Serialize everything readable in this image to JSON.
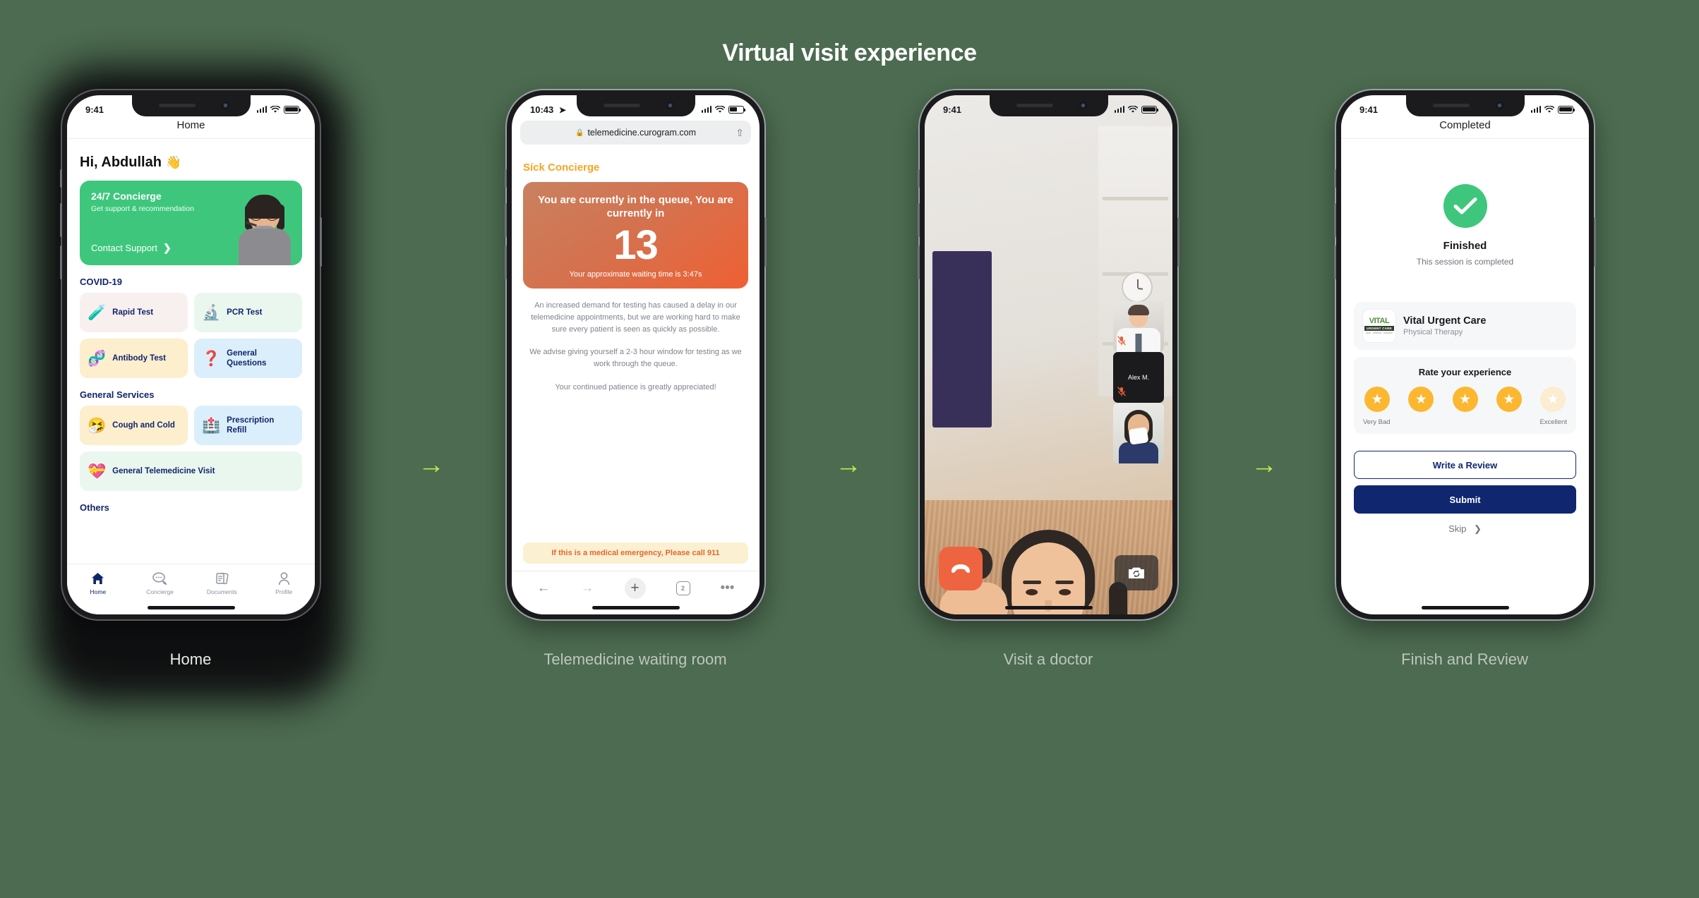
{
  "page": {
    "title": "Virtual visit experience",
    "background": "#4c6b50",
    "arrow_color": "#c4e84b",
    "arrow_glyph": "→"
  },
  "captions": {
    "one": "Home",
    "two": "Telemedicine waiting room",
    "three": "Visit a doctor",
    "four": "Finish and Review"
  },
  "screen_home": {
    "status": {
      "time": "9:41",
      "location_arrow": "",
      "signal": "signal-icon",
      "wifi": "▾",
      "battery": "battery-icon"
    },
    "nav_title": "Home",
    "greeting": "Hi, Abdullah",
    "greeting_emoji": "👋",
    "concierge": {
      "title": "24/7 Concierge",
      "subtitle": "Get support & recommendation",
      "cta": "Contact Support",
      "chevron": "❯",
      "color": "#3ec77c"
    },
    "sections": [
      {
        "title": "COVID-19",
        "tiles": [
          {
            "label": "Rapid Test",
            "emoji": "🧪",
            "bg": "#f8f0ee",
            "wide": false
          },
          {
            "label": "PCR Test",
            "emoji": "🔬",
            "bg": "#eaf7ef",
            "wide": false
          },
          {
            "label": "Antibody Test",
            "emoji": "🧬",
            "bg": "#fdeecd",
            "wide": false
          },
          {
            "label": "General Questions",
            "emoji": "❓",
            "bg": "#dbeefb",
            "wide": false
          }
        ]
      },
      {
        "title": "General Services",
        "tiles": [
          {
            "label": "Cough and Cold",
            "emoji": "🤧",
            "bg": "#fdeecd",
            "wide": false
          },
          {
            "label": "Prescription Refill",
            "emoji": "🏥",
            "bg": "#dbeefb",
            "wide": false
          },
          {
            "label": "General Telemedicine Visit",
            "emoji": "💝",
            "bg": "#eaf7ef",
            "wide": true
          }
        ]
      },
      {
        "title": "Others",
        "tiles": []
      }
    ],
    "tabs": [
      {
        "label": "Home",
        "icon": "home-icon",
        "glyph": "🏠",
        "active": true
      },
      {
        "label": "Concierge",
        "icon": "chat-icon",
        "glyph": "💬",
        "active": false
      },
      {
        "label": "Documents",
        "icon": "documents-icon",
        "glyph": "📄",
        "active": false
      },
      {
        "label": "Profile",
        "icon": "profile-icon",
        "glyph": "👤",
        "active": false
      }
    ]
  },
  "screen_waiting": {
    "status": {
      "time": "10:43",
      "location_arrow": "➤"
    },
    "url": "telemedicine.curogram.com",
    "lock": "🔒",
    "share": "⇧",
    "brand": "Síck Concierge",
    "queue": {
      "headline": "You are currently in the queue, You are currently in",
      "number": "13",
      "wait": "Your approximate waiting time is 3:47s",
      "gradient_from": "#c9815f",
      "gradient_to": "#ef6033"
    },
    "paragraphs": [
      "An increased demand for testing has caused a delay in our telemedicine appointments, but we are working hard to make sure every patient is seen as quickly as possible.",
      "We advise giving yourself a 2-3 hour window for testing as we work through the queue.",
      "Your continued patience is greatly appreciated!"
    ],
    "emergency": "If this is a medical emergency, Please call 911",
    "toolbar": {
      "back": "←",
      "forward": "→",
      "add": "+",
      "tabs_count": "2",
      "more": "•••"
    }
  },
  "screen_call": {
    "status": {
      "time": "9:41"
    },
    "participant_name": "Alex M.",
    "mute_icon": "muted-mic-icon",
    "mute_glyph": "🔇",
    "end_call": {
      "icon": "end-call-icon",
      "color": "#ef6440"
    },
    "flip_camera": {
      "icon": "flip-camera-icon",
      "glyph": "↻"
    }
  },
  "screen_review": {
    "status": {
      "time": "9:41"
    },
    "nav_title": "Completed",
    "check_icon": "check-icon",
    "check_glyph": "✔",
    "finished_title": "Finished",
    "finished_sub": "This session is completed",
    "clinic": {
      "logo_line1": "VITAL",
      "logo_line2": "URGENT CARE",
      "logo_line3": "sport · wellness · medicine",
      "name": "Vital Urgent Care",
      "specialty": "Physical Therapy"
    },
    "rating": {
      "title": "Rate your experience",
      "stars_total": 5,
      "stars_filled": 4,
      "star_glyph": "★",
      "low_label": "Very Bad",
      "high_label": "Excellent",
      "active_color": "#fcb731"
    },
    "write_review": "Write a Review",
    "submit": "Submit",
    "skip": "Skip",
    "skip_chevron": "❯",
    "accent": "#10266f"
  }
}
